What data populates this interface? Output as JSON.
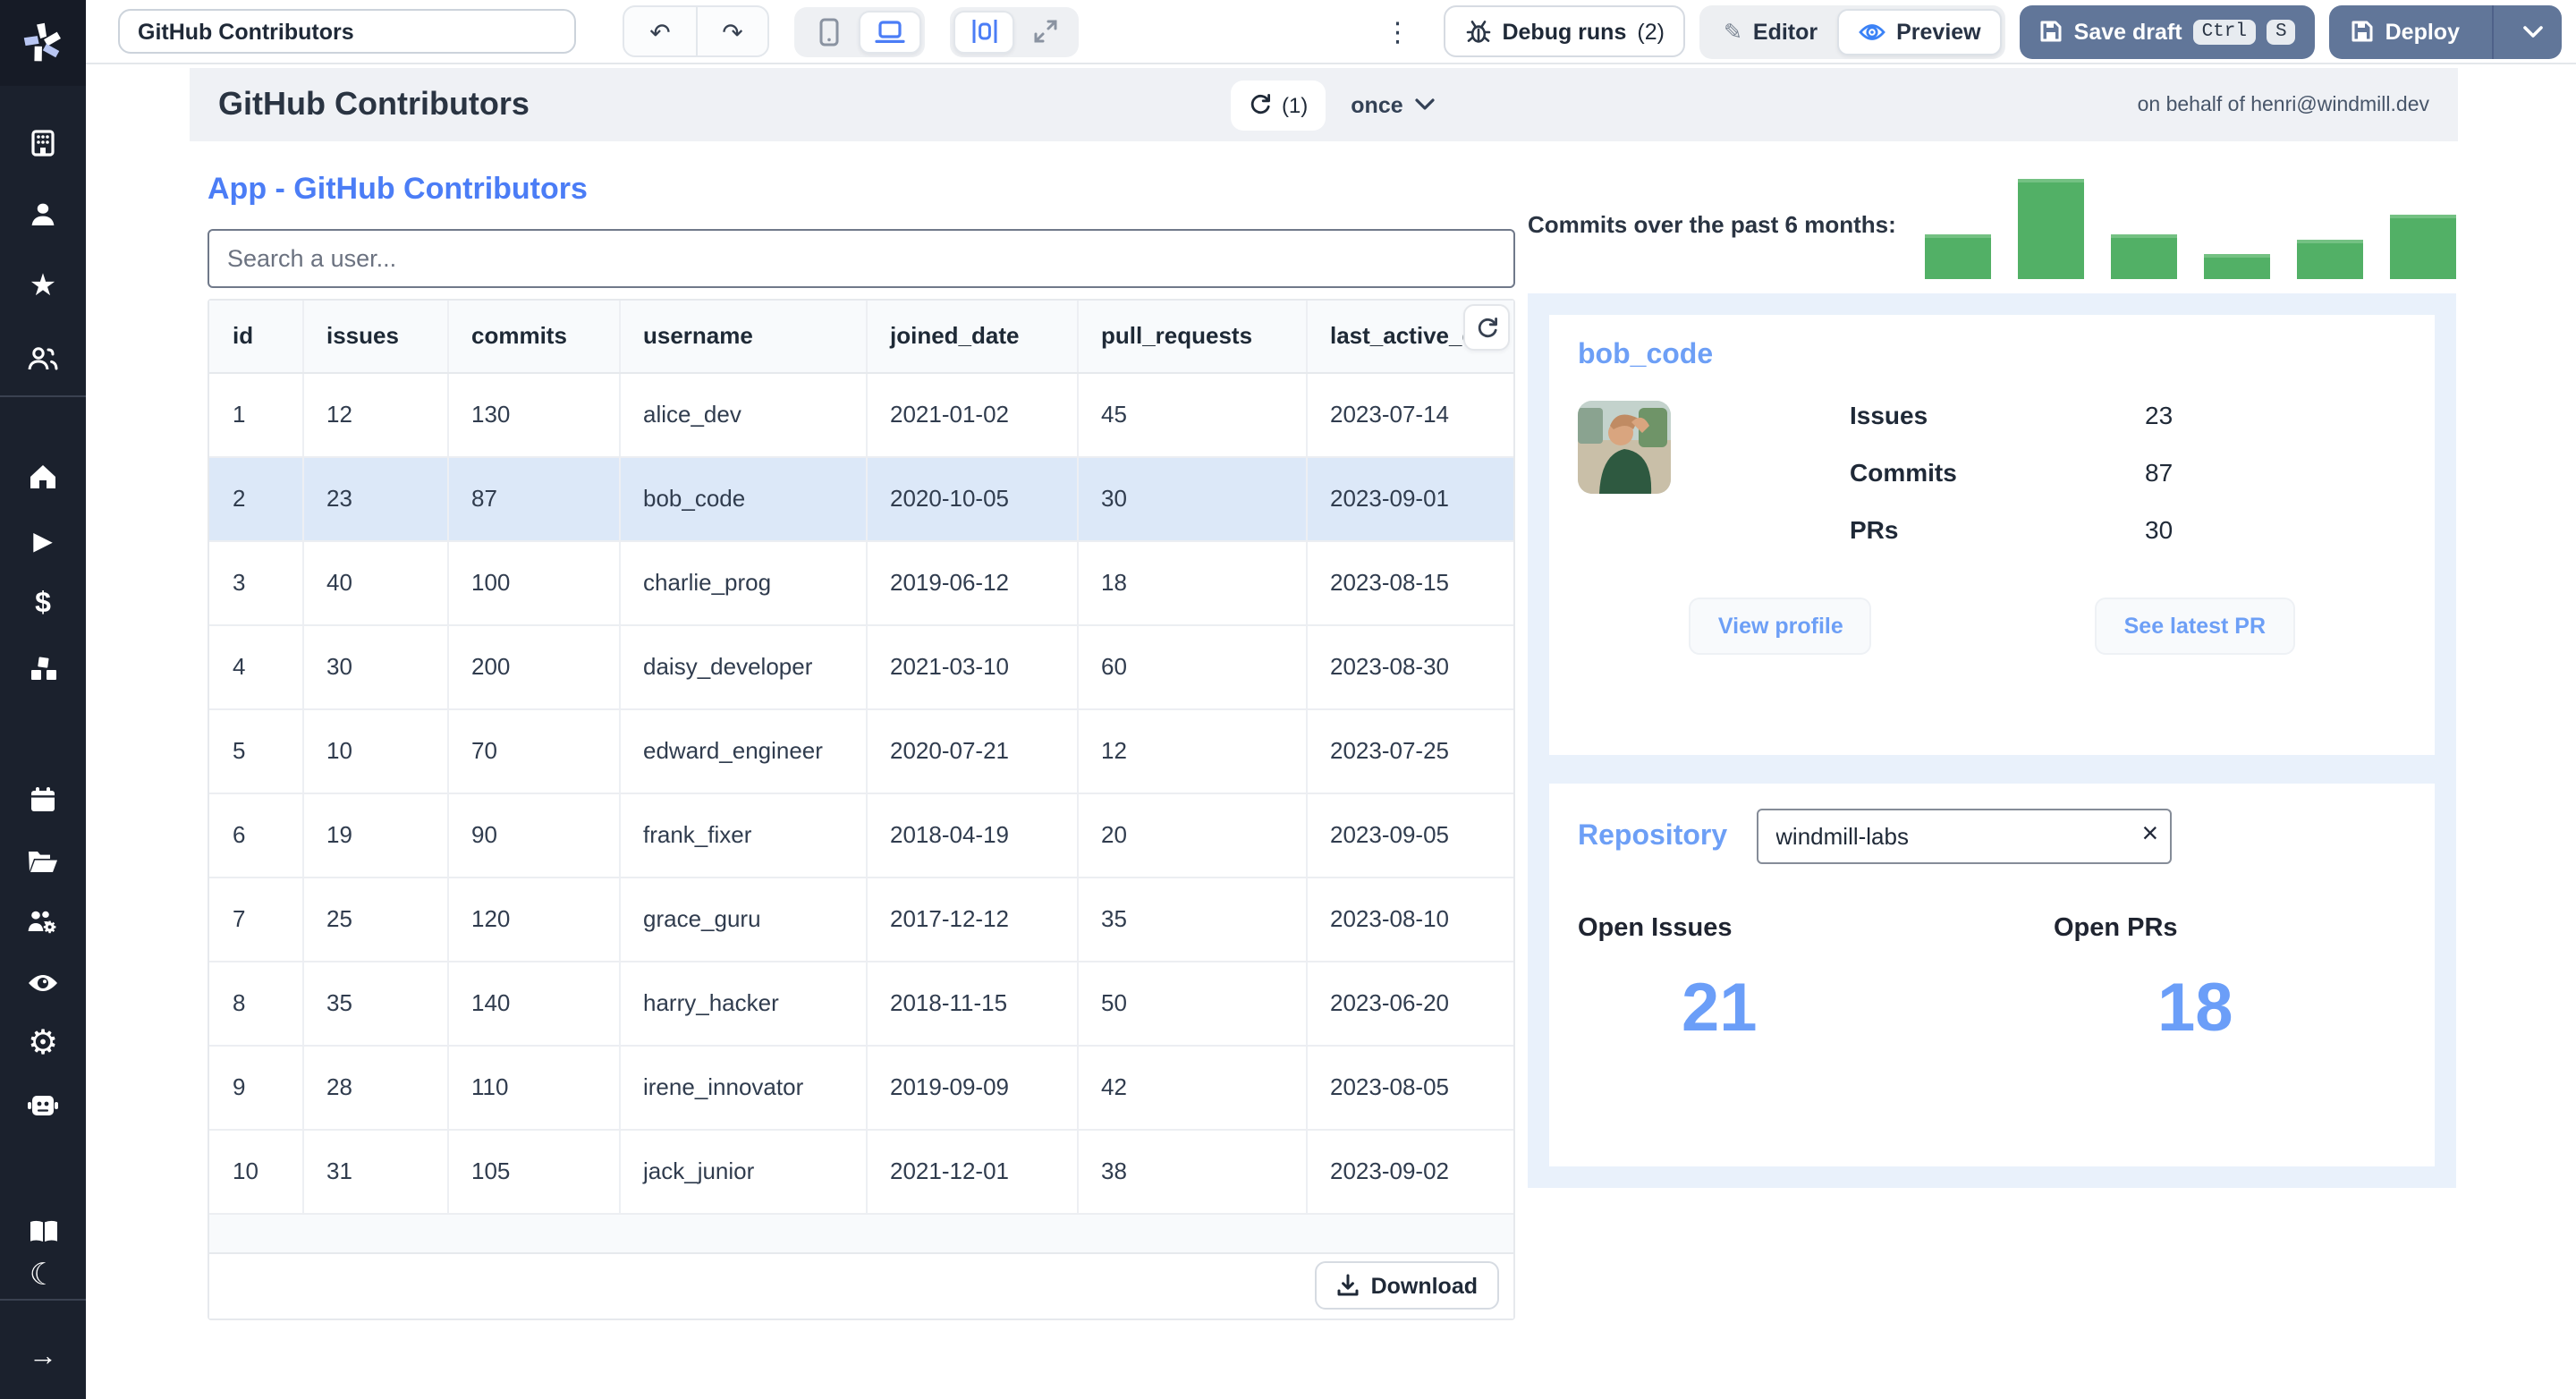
{
  "colors": {
    "accent_blue": "#4b7df6",
    "light_blue": "#6d9ff6",
    "slate_button": "#617699",
    "green_bar": "#52b066",
    "selected_row": "#dce8f8",
    "rail_bg": "#1b212d",
    "panel_bg": "#e9f1fb"
  },
  "sidebar": {
    "items": [
      "building",
      "user",
      "star",
      "users",
      "home",
      "play",
      "dollar",
      "cubes",
      "calendar",
      "folder",
      "user-cog",
      "eye",
      "gear",
      "robot",
      "book",
      "moon",
      "arrow-right"
    ]
  },
  "topbar": {
    "app_title": "GitHub Contributors",
    "undo": "undo",
    "redo": "redo",
    "debug_label": "Debug runs",
    "debug_count": "(2)",
    "editor_label": "Editor",
    "preview_label": "Preview",
    "save_label": "Save draft",
    "kbd_ctrl": "Ctrl",
    "kbd_s": "S",
    "deploy_label": "Deploy"
  },
  "header": {
    "title": "GitHub Contributors",
    "refresh_badge": "(1)",
    "schedule": "once",
    "on_behalf": "on behalf of henri@windmill.dev"
  },
  "app": {
    "heading": "App - GitHub Contributors",
    "search_placeholder": "Search a user..."
  },
  "table": {
    "columns": [
      "id",
      "issues",
      "commits",
      "username",
      "joined_date",
      "pull_requests",
      "last_active_date"
    ],
    "rows": [
      [
        "1",
        "12",
        "130",
        "alice_dev",
        "2021-01-02",
        "45",
        "2023-07-14"
      ],
      [
        "2",
        "23",
        "87",
        "bob_code",
        "2020-10-05",
        "30",
        "2023-09-01"
      ],
      [
        "3",
        "40",
        "100",
        "charlie_prog",
        "2019-06-12",
        "18",
        "2023-08-15"
      ],
      [
        "4",
        "30",
        "200",
        "daisy_developer",
        "2021-03-10",
        "60",
        "2023-08-30"
      ],
      [
        "5",
        "10",
        "70",
        "edward_engineer",
        "2020-07-21",
        "12",
        "2023-07-25"
      ],
      [
        "6",
        "19",
        "90",
        "frank_fixer",
        "2018-04-19",
        "20",
        "2023-09-05"
      ],
      [
        "7",
        "25",
        "120",
        "grace_guru",
        "2017-12-12",
        "35",
        "2023-08-10"
      ],
      [
        "8",
        "35",
        "140",
        "harry_hacker",
        "2018-11-15",
        "50",
        "2023-06-20"
      ],
      [
        "9",
        "28",
        "110",
        "irene_innovator",
        "2019-09-09",
        "42",
        "2023-08-05"
      ],
      [
        "10",
        "31",
        "105",
        "jack_junior",
        "2021-12-01",
        "38",
        "2023-09-02"
      ]
    ],
    "selected_row_index": 1,
    "download_label": "Download"
  },
  "chart_data": {
    "type": "bar",
    "title": "Commits over the past 6 months:",
    "categories": [
      "",
      "",
      "",
      "",
      "",
      ""
    ],
    "values": [
      45,
      100,
      45,
      25,
      40,
      65
    ],
    "ylim": [
      0,
      100
    ],
    "legend": false,
    "color": "#52b066"
  },
  "user_card": {
    "title": "bob_code",
    "stats": [
      {
        "label": "Issues",
        "value": "23"
      },
      {
        "label": "Commits",
        "value": "87"
      },
      {
        "label": "PRs",
        "value": "30"
      }
    ],
    "view_profile": "View profile",
    "see_latest_pr": "See latest PR"
  },
  "repo_card": {
    "title": "Repository",
    "input_value": "windmill-labs",
    "stats": [
      {
        "label": "Open Issues",
        "value": "21"
      },
      {
        "label": "Open PRs",
        "value": "18"
      }
    ]
  }
}
